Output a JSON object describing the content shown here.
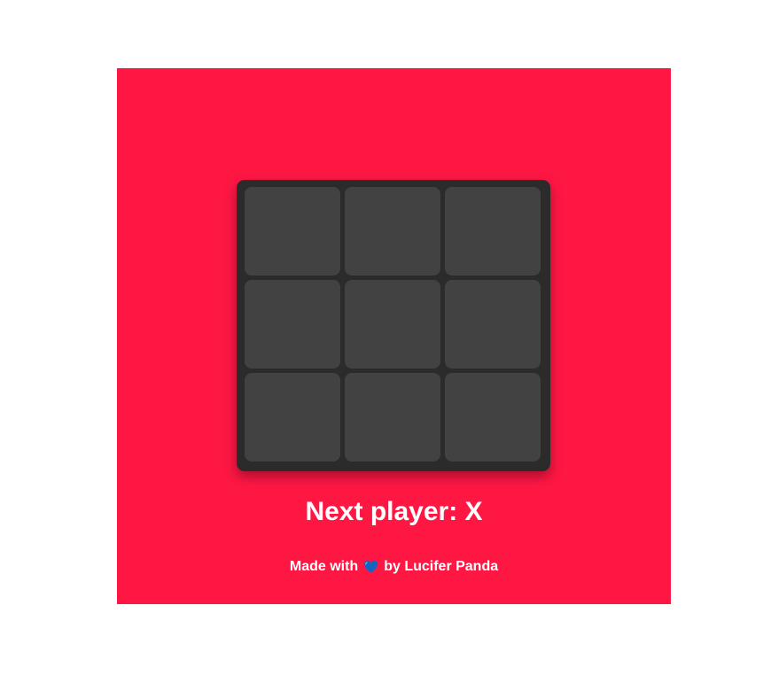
{
  "game": {
    "cells": [
      "",
      "",
      "",
      "",
      "",
      "",
      "",
      "",
      ""
    ],
    "status": "Next player: X"
  },
  "footer": {
    "prefix": "Made with",
    "icon": "blue-heart-icon",
    "suffix": "by Lucifer Panda"
  },
  "colors": {
    "background": "#ff1744",
    "board": "#2b2b2b",
    "cell": "#424242",
    "text": "#ffffff",
    "heart": "#1565c0"
  }
}
